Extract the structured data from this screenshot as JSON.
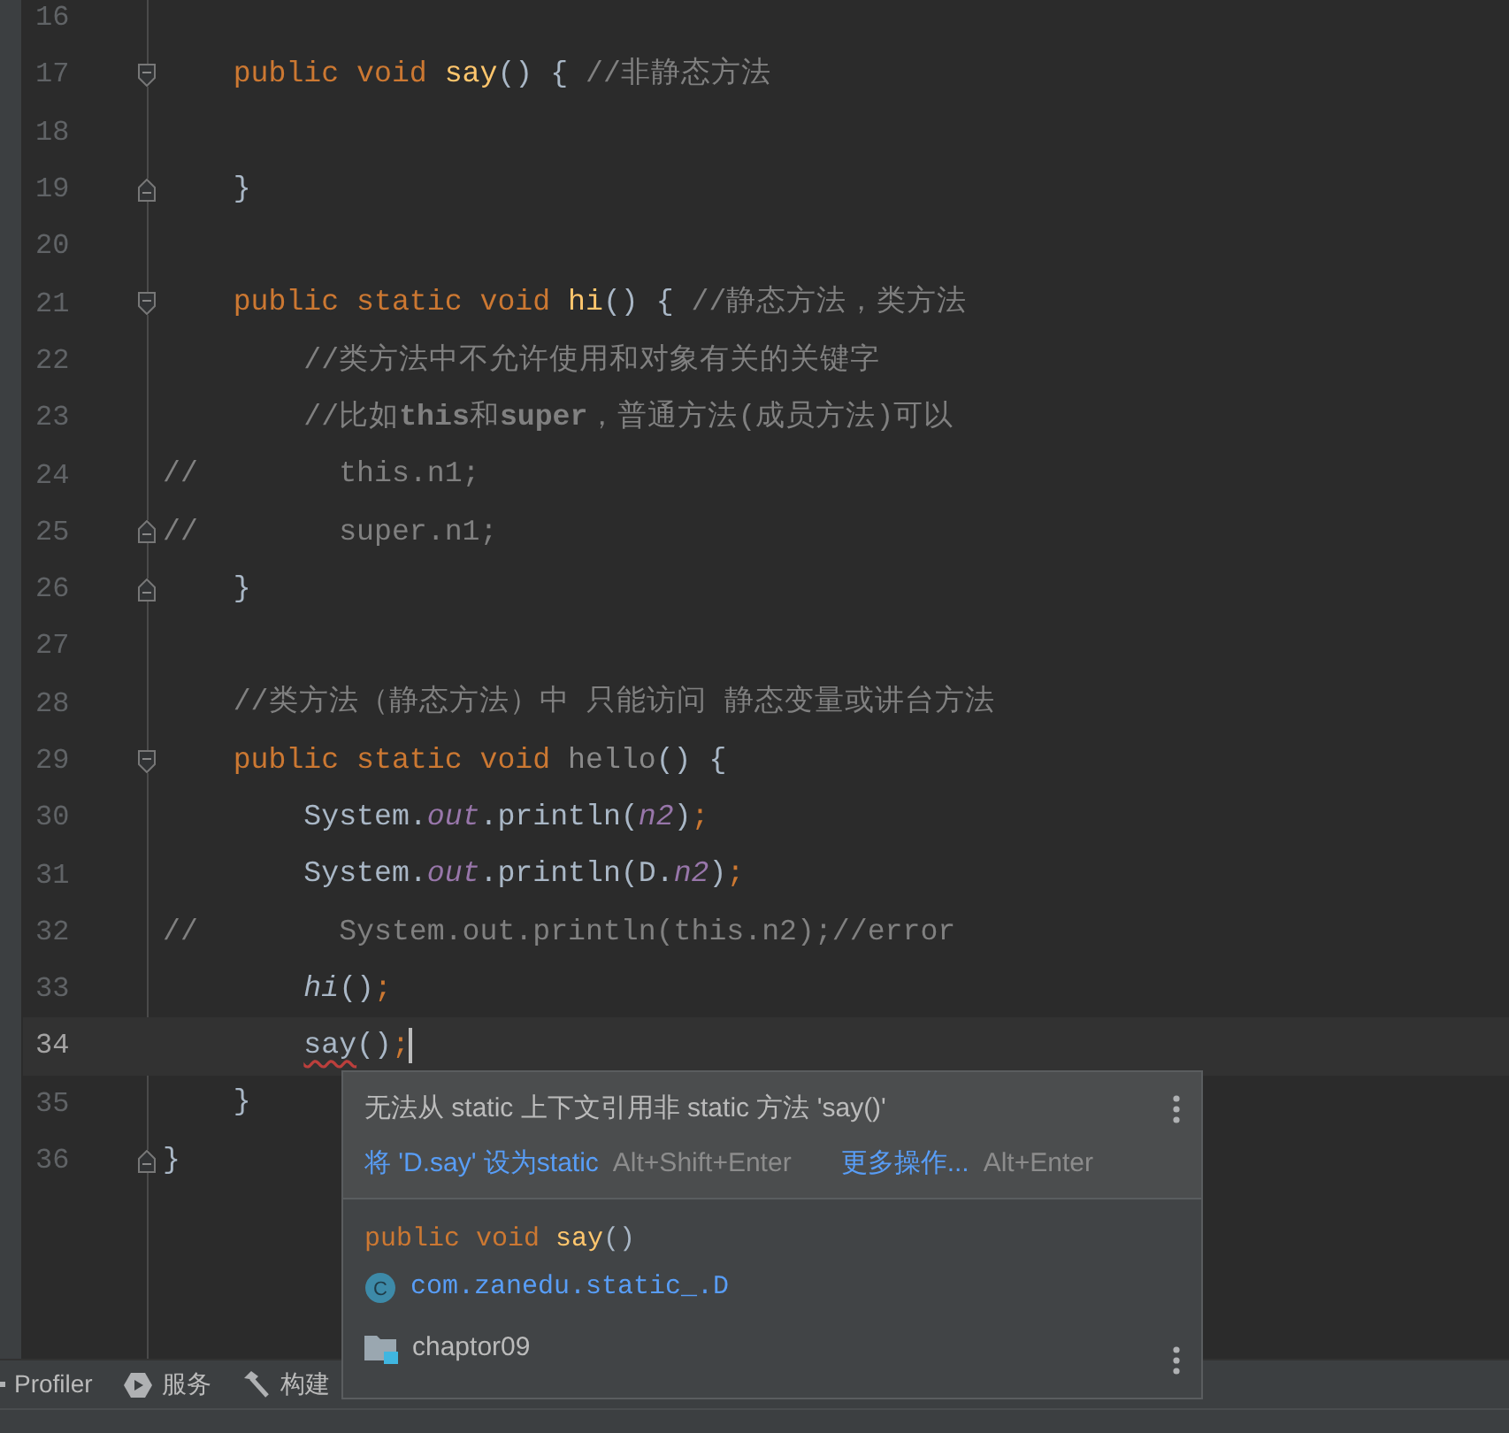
{
  "editor": {
    "lines": [
      {
        "number": "16",
        "current": false
      },
      {
        "number": "17",
        "current": false,
        "fold_start": true,
        "tokens": [
          {
            "text": "    public void ",
            "kind": "keyword"
          },
          {
            "text": "say",
            "kind": "declaration"
          },
          {
            "text": "() { ",
            "kind": "plain"
          },
          {
            "text": "//非静态方法",
            "kind": "comment"
          }
        ]
      },
      {
        "number": "18",
        "current": false
      },
      {
        "number": "19",
        "current": false,
        "fold_end": true,
        "tokens": [
          {
            "text": "    }",
            "kind": "plain"
          }
        ]
      },
      {
        "number": "20",
        "current": false
      },
      {
        "number": "21",
        "current": false,
        "fold_start": true,
        "tokens": [
          {
            "text": "    public static void ",
            "kind": "keyword"
          },
          {
            "text": "hi",
            "kind": "declaration"
          },
          {
            "text": "() { ",
            "kind": "plain"
          },
          {
            "text": "//静态方法，类方法",
            "kind": "comment"
          }
        ]
      },
      {
        "number": "22",
        "current": false,
        "tokens": [
          {
            "text": "        //类方法中不允许使用和对象有关的关键字",
            "kind": "comment"
          }
        ]
      },
      {
        "number": "23",
        "current": false,
        "tokens": [
          {
            "text": "        //比如",
            "kind": "comment"
          },
          {
            "text": "this",
            "kind": "comment_bold"
          },
          {
            "text": "和",
            "kind": "comment"
          },
          {
            "text": "super",
            "kind": "comment_bold"
          },
          {
            "text": "，普通方法(成员方法)可以",
            "kind": "comment"
          }
        ]
      },
      {
        "number": "24",
        "current": false,
        "tokens": [
          {
            "text": "//        this.n1;",
            "kind": "comment"
          }
        ]
      },
      {
        "number": "25",
        "current": false,
        "fold_end": true,
        "tokens": [
          {
            "text": "//        super.n1;",
            "kind": "comment"
          }
        ]
      },
      {
        "number": "26",
        "current": false,
        "fold_end": true,
        "tokens": [
          {
            "text": "    }",
            "kind": "plain"
          }
        ]
      },
      {
        "number": "27",
        "current": false
      },
      {
        "number": "28",
        "current": false,
        "tokens": [
          {
            "text": "    //类方法（静态方法）中 只能访问 静态变量或讲台方法",
            "kind": "comment"
          }
        ]
      },
      {
        "number": "29",
        "current": false,
        "fold_start": true,
        "tokens": [
          {
            "text": "    public static void ",
            "kind": "keyword"
          },
          {
            "text": "hello",
            "kind": "unused"
          },
          {
            "text": "() {",
            "kind": "plain"
          }
        ]
      },
      {
        "number": "30",
        "current": false,
        "tokens": [
          {
            "text": "        System.",
            "kind": "plain"
          },
          {
            "text": "out",
            "kind": "field"
          },
          {
            "text": ".println(",
            "kind": "plain"
          },
          {
            "text": "n2",
            "kind": "field"
          },
          {
            "text": ")",
            "kind": "plain"
          },
          {
            "text": ";",
            "kind": "keyword"
          }
        ]
      },
      {
        "number": "31",
        "current": false,
        "tokens": [
          {
            "text": "        System.",
            "kind": "plain"
          },
          {
            "text": "out",
            "kind": "field"
          },
          {
            "text": ".println(D.",
            "kind": "plain"
          },
          {
            "text": "n2",
            "kind": "field"
          },
          {
            "text": ")",
            "kind": "plain"
          },
          {
            "text": ";",
            "kind": "keyword"
          }
        ]
      },
      {
        "number": "32",
        "current": false,
        "tokens": [
          {
            "text": "//        System.out.println(this.n2);//error",
            "kind": "comment"
          }
        ]
      },
      {
        "number": "33",
        "current": false,
        "tokens": [
          {
            "text": "        hi",
            "kind": "static_call"
          },
          {
            "text": "()",
            "kind": "plain"
          },
          {
            "text": ";",
            "kind": "keyword"
          }
        ]
      },
      {
        "number": "34",
        "current": true,
        "caret": true,
        "tokens": [
          {
            "text": "        say",
            "kind": "error"
          },
          {
            "text": "()",
            "kind": "plain"
          },
          {
            "text": ";",
            "kind": "keyword"
          }
        ]
      },
      {
        "number": "35",
        "current": false,
        "tokens": [
          {
            "text": "    }",
            "kind": "plain"
          }
        ]
      },
      {
        "number": "36",
        "current": false,
        "fold_end": true,
        "tokens": [
          {
            "text": "}",
            "kind": "plain"
          }
        ]
      }
    ]
  },
  "popup": {
    "message": "无法从 static 上下文引用非 static 方法 'say()'",
    "actions": [
      {
        "label": "将 'D.say' 设为static",
        "shortcut": "Alt+Shift+Enter"
      },
      {
        "label": "更多操作...",
        "shortcut": "Alt+Enter"
      }
    ],
    "signature": [
      {
        "text": "public void ",
        "kind": "keyword"
      },
      {
        "text": "say",
        "kind": "declaration"
      },
      {
        "text": "()",
        "kind": "plain"
      }
    ],
    "class_icon": "C",
    "class_name": "com.zanedu.static_.D",
    "module": "chaptor09"
  },
  "tool_window_bar": [
    {
      "label": "Profiler"
    },
    {
      "label": "服务"
    },
    {
      "label": "构建"
    }
  ]
}
